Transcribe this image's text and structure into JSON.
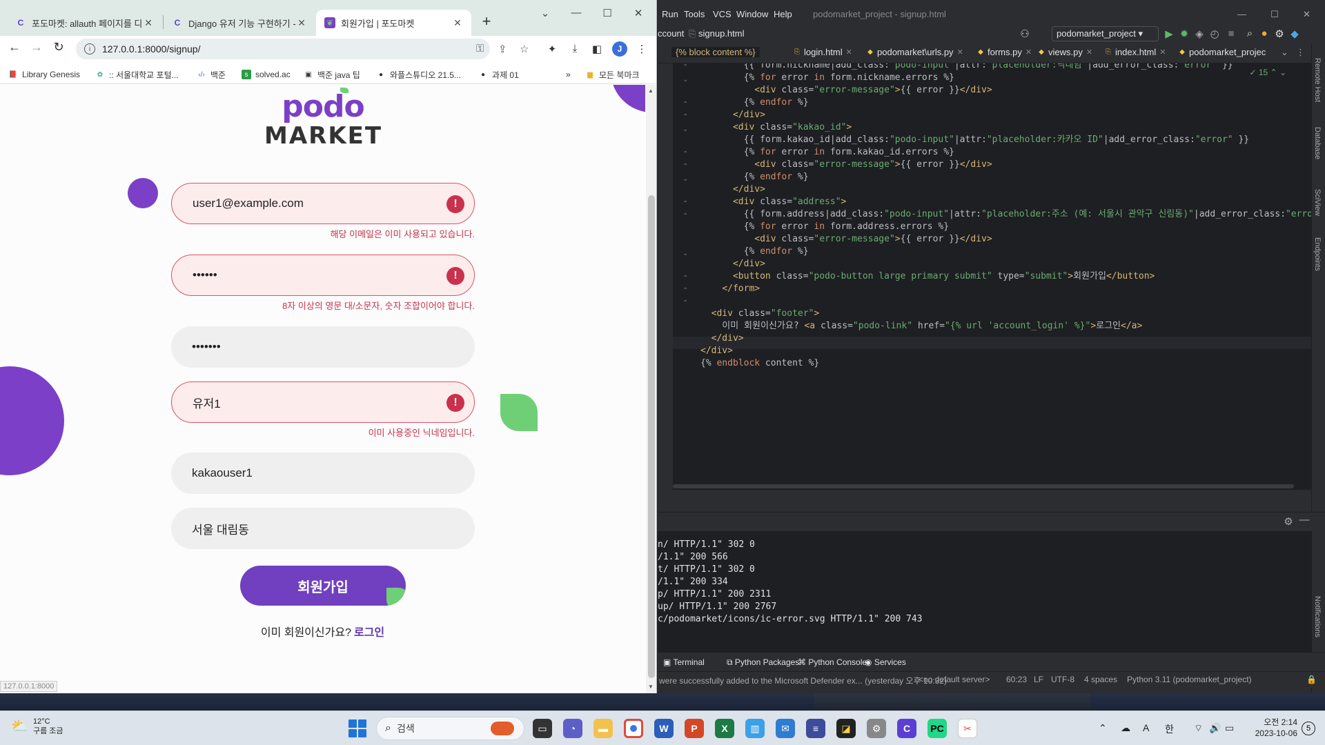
{
  "browser": {
    "tabs": [
      {
        "label": "포도마켓: allauth 페이지를 디",
        "icon": "C"
      },
      {
        "label": "Django 유저 기능 구현하기 -",
        "icon": "C"
      },
      {
        "label": "회원가입 | 포도마켓",
        "icon": "leaf"
      }
    ],
    "url": "127.0.0.1:8000/signup/",
    "bookmarks": [
      "Library Genesis",
      ":: 서울대학교 포털...",
      "백준",
      "solved.ac",
      "백준 java 팁",
      "와플스튜디오 21.5...",
      "과제 01",
      "모든 북마크"
    ],
    "status_url": "127.0.0.1:8000"
  },
  "signup": {
    "logo_top": "podo",
    "logo_bottom": "MARKET",
    "fields": [
      {
        "value": "user1@example.com",
        "error": "해당 이메일은 이미 사용되고 있습니다."
      },
      {
        "value": "••••••",
        "error": "8자 이상의 영문 대/소문자, 숫자 조합이어야 합니다."
      },
      {
        "value": "•••••••",
        "error": ""
      },
      {
        "value": "유저1",
        "error": "이미 사용중인 닉네임입니다."
      },
      {
        "value": "kakaouser1",
        "error": ""
      },
      {
        "value": "서울 대림동",
        "error": ""
      }
    ],
    "submit_label": "회원가입",
    "footer_text": "이미 회원이신가요?",
    "footer_link": "로그인"
  },
  "ide": {
    "menus": [
      "Run",
      "Tools",
      "VCS",
      "Window",
      "Help"
    ],
    "title": "podomarket_project - signup.html",
    "breadcrumb_left": "ccount",
    "breadcrumb_file": "signup.html",
    "run_config": "podomarket_project",
    "editor_tabs": [
      "{% block content %}",
      "login.html",
      "podomarket\\urls.py",
      "forms.py",
      "views.py",
      "index.html",
      "podomarket_projec"
    ],
    "inspection_count": "15",
    "terminal_lines": [
      "n/ HTTP/1.1\" 302 0",
      "/1.1\" 200 566",
      "t/ HTTP/1.1\" 302 0",
      "/1.1\" 200 334",
      "p/ HTTP/1.1\" 200 2311",
      "up/ HTTP/1.1\" 200 2767",
      "c/podomarket/icons/ic-error.svg HTTP/1.1\" 200 743"
    ],
    "bottom_tabs": [
      "Terminal",
      "Python Packages",
      "Python Console",
      "Services"
    ],
    "status": {
      "message": "were successfully added to the Microsoft Defender ex... (yesterday 오후 10:32)",
      "server": "<no default server>",
      "position": "60:23",
      "line_sep": "LF",
      "encoding": "UTF-8",
      "indent": "4 spaces",
      "interpreter": "Python 3.11 (podomarket_project)"
    },
    "right_tools": [
      "Remote Host",
      "Database",
      "SciView",
      "Endpoints",
      "Notifications"
    ]
  },
  "taskbar": {
    "temp": "12°C",
    "weather": "구름 조금",
    "search_placeholder": "검색",
    "ime": "한",
    "time": "오전 2:14",
    "date": "2023-10-06",
    "notif_count": "5",
    "font_letter": "A"
  }
}
